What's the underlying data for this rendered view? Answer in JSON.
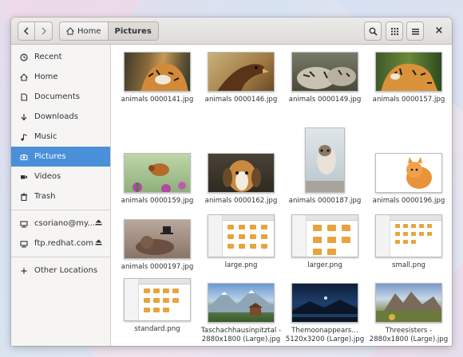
{
  "toolbar": {
    "back_icon": "chevron-left-icon",
    "forward_icon": "chevron-right-icon",
    "home_crumb": "Home",
    "current_crumb": "Pictures",
    "search_icon": "search-icon",
    "view_icon": "grid-view-icon",
    "menu_icon": "hamburger-menu-icon",
    "close_label": "×"
  },
  "sidebar": {
    "items": [
      {
        "label": "Recent",
        "icon": "clock-icon"
      },
      {
        "label": "Home",
        "icon": "home-icon"
      },
      {
        "label": "Documents",
        "icon": "document-icon"
      },
      {
        "label": "Downloads",
        "icon": "download-icon"
      },
      {
        "label": "Music",
        "icon": "music-icon"
      },
      {
        "label": "Pictures",
        "icon": "camera-icon",
        "selected": true
      },
      {
        "label": "Videos",
        "icon": "video-icon"
      },
      {
        "label": "Trash",
        "icon": "trash-icon"
      }
    ],
    "mounts": [
      {
        "label": "csoriano@my...",
        "icon": "network-folder-icon"
      },
      {
        "label": "ftp.redhat.com",
        "icon": "network-folder-icon"
      }
    ],
    "other": {
      "label": "Other Locations",
      "icon": "plus-icon"
    }
  },
  "files": [
    {
      "name": "animals 0000141.jpg"
    },
    {
      "name": "animals 0000146.jpg"
    },
    {
      "name": "animals 0000149.jpg"
    },
    {
      "name": "animals 0000157.jpg"
    },
    {
      "name": "animals 0000159.jpg"
    },
    {
      "name": "animals 0000162.jpg"
    },
    {
      "name": "animals 0000187.jpg"
    },
    {
      "name": "animals 0000196.jpg"
    },
    {
      "name": "animals 0000197.jpg"
    },
    {
      "name": "large.png"
    },
    {
      "name": "larger.png"
    },
    {
      "name": "small.png"
    },
    {
      "name": "standard.png"
    },
    {
      "name": "Taschachhausinpitztal - 2880x1800 (Large).jpg"
    },
    {
      "name": "Themoonappears… 5120x3200 (Large).jpg"
    },
    {
      "name": "Threesisters - 2880x1800 (Large).jpg"
    }
  ],
  "colors": {
    "selection": "#4a90d9",
    "sidebar_bg": "#f6f5f4",
    "folder": "#e8a33d"
  }
}
